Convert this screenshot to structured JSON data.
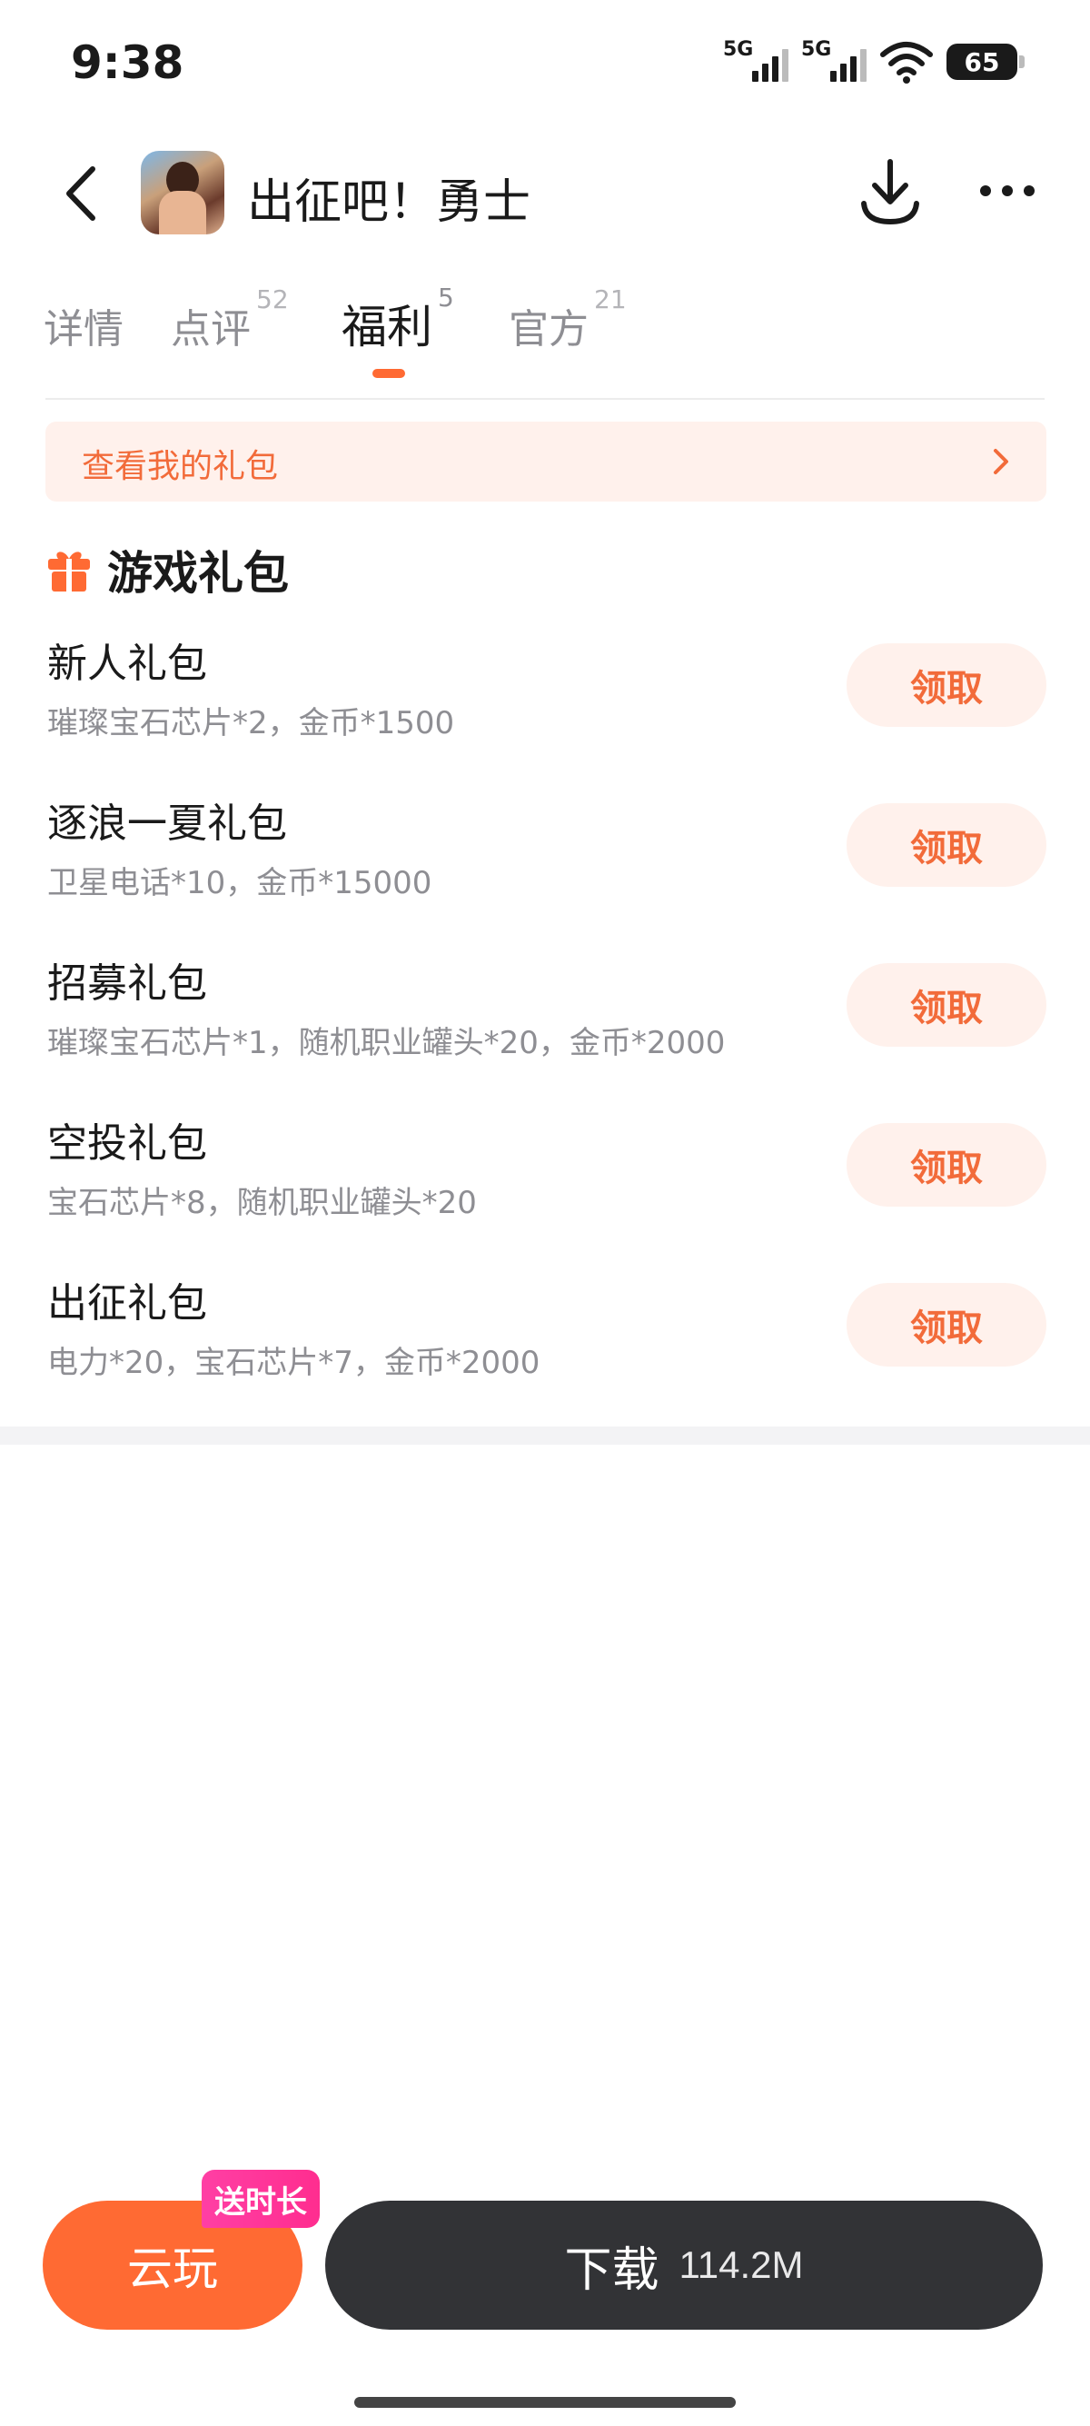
{
  "status_bar": {
    "time": "9:38",
    "signal1": "5G",
    "signal2": "5G",
    "battery": "65",
    "icons": [
      "signal-icon",
      "signal-icon",
      "wifi-icon",
      "battery-icon"
    ]
  },
  "header": {
    "title": "出征吧！勇士",
    "icons": [
      "back-icon",
      "app-icon",
      "download-icon",
      "more-icon"
    ]
  },
  "tabs": [
    {
      "label": "详情",
      "count": ""
    },
    {
      "label": "点评",
      "count": "52"
    },
    {
      "label": "福利",
      "count": "5"
    },
    {
      "label": "官方",
      "count": "21"
    }
  ],
  "active_tab": "福利",
  "my_gifts": {
    "label": "查看我的礼包",
    "icon": "chevron-right-icon"
  },
  "section": {
    "title": "游戏礼包",
    "icon": "gift-icon"
  },
  "gifts": [
    {
      "name": "新人礼包",
      "desc": "璀璨宝石芯片*2，金币*1500",
      "button": "领取"
    },
    {
      "name": "逐浪一夏礼包",
      "desc": "卫星电话*10，金币*15000",
      "button": "领取"
    },
    {
      "name": "招募礼包",
      "desc": "璀璨宝石芯片*1，随机职业罐头*20，金币*2000",
      "button": "领取"
    },
    {
      "name": "空投礼包",
      "desc": "宝石芯片*8，随机职业罐头*20",
      "button": "领取"
    },
    {
      "name": "出征礼包",
      "desc": "电力*20，宝石芯片*7，金币*2000",
      "button": "领取"
    }
  ],
  "bottom": {
    "cloud_label": "云玩",
    "cloud_badge": "送时长",
    "download_label": "下载",
    "download_size": "114.2M"
  },
  "colors": {
    "accent": "#ff6a33",
    "accent_light": "#fff1ec",
    "dark_button": "#323336",
    "badge": "#ff2d8f"
  }
}
